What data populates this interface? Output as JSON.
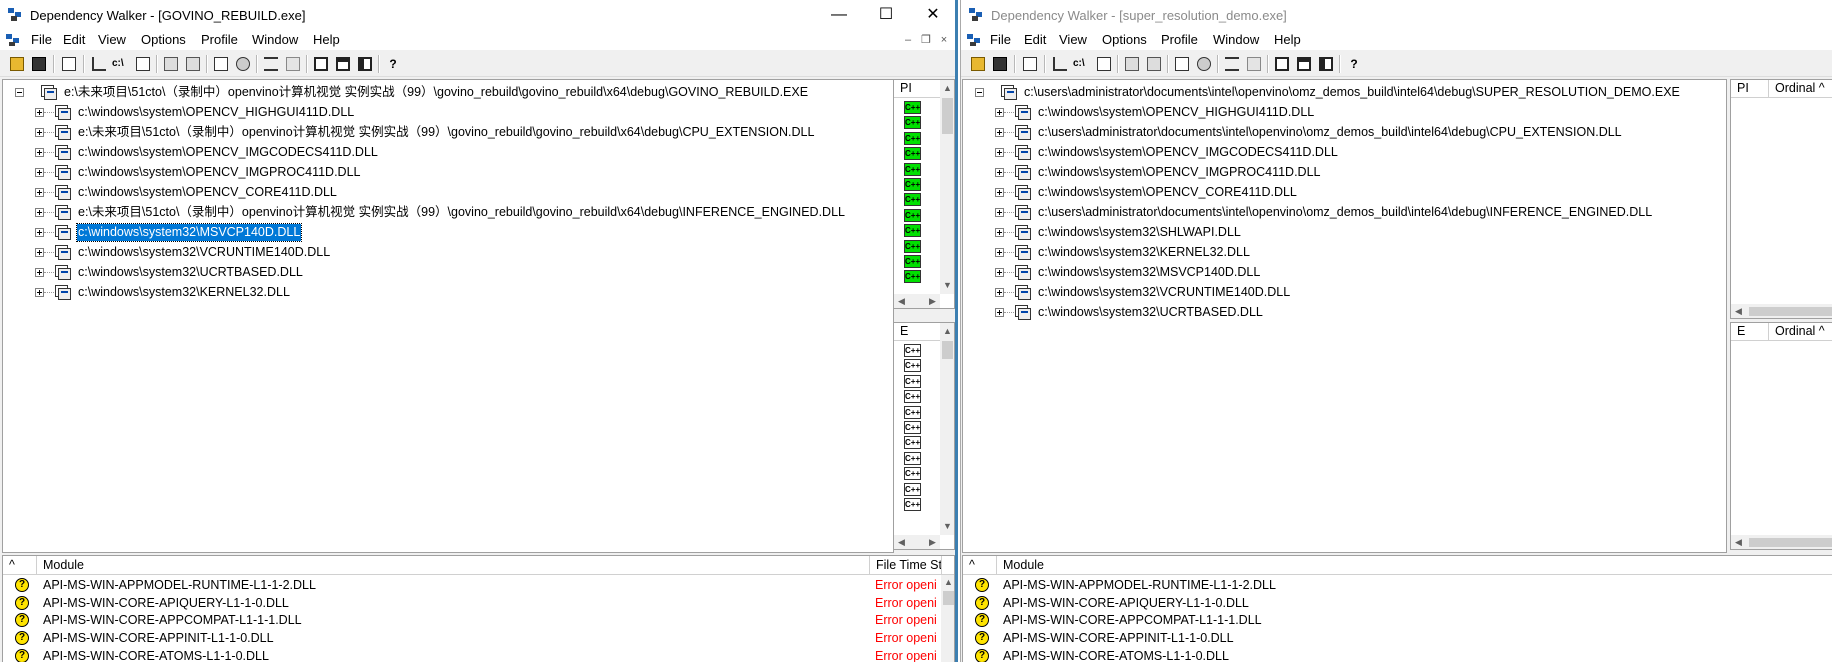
{
  "left": {
    "title": "Dependency Walker - [GOVINO_REBUILD.exe]",
    "menu": [
      "File",
      "Edit",
      "View",
      "Options",
      "Profile",
      "Window",
      "Help"
    ],
    "tree_root": "e:\\未来项目\\51cto\\（录制中）openvino计算机视觉 实例实战（99）\\govino_rebuild\\govino_rebuild\\x64\\debug\\GOVINO_REBUILD.EXE",
    "tree_items": [
      "c:\\windows\\system\\OPENCV_HIGHGUI411D.DLL",
      "e:\\未来项目\\51cto\\（录制中）openvino计算机视觉 实例实战（99）\\govino_rebuild\\govino_rebuild\\x64\\debug\\CPU_EXTENSION.DLL",
      "c:\\windows\\system\\OPENCV_IMGCODECS411D.DLL",
      "c:\\windows\\system\\OPENCV_IMGPROC411D.DLL",
      "c:\\windows\\system\\OPENCV_CORE411D.DLL",
      "e:\\未来项目\\51cto\\（录制中）openvino计算机视觉 实例实战（99）\\govino_rebuild\\govino_rebuild\\x64\\debug\\INFERENCE_ENGINED.DLL",
      "c:\\windows\\system32\\MSVCP140D.DLL",
      "c:\\windows\\system32\\VCRUNTIME140D.DLL",
      "c:\\windows\\system32\\UCRTBASED.DLL",
      "c:\\windows\\system32\\KERNEL32.DLL"
    ],
    "selected_index": 6,
    "pi_header": "PI",
    "e_header": "E",
    "cpp_glyph": "C++",
    "pi_count": 12,
    "e_count": 11,
    "log_headers": {
      "sort": "^",
      "module": "Module",
      "filetime": "File Time St"
    },
    "log_rows": [
      {
        "module": "API-MS-WIN-APPMODEL-RUNTIME-L1-1-2.DLL",
        "status": "Error openi"
      },
      {
        "module": "API-MS-WIN-CORE-APIQUERY-L1-1-0.DLL",
        "status": "Error openi"
      },
      {
        "module": "API-MS-WIN-CORE-APPCOMPAT-L1-1-1.DLL",
        "status": "Error openi"
      },
      {
        "module": "API-MS-WIN-CORE-APPINIT-L1-1-0.DLL",
        "status": "Error openi"
      },
      {
        "module": "API-MS-WIN-CORE-ATOMS-L1-1-0.DLL",
        "status": "Error openi"
      }
    ]
  },
  "right": {
    "title": "Dependency Walker - [super_resolution_demo.exe]",
    "menu": [
      "File",
      "Edit",
      "View",
      "Options",
      "Profile",
      "Window",
      "Help"
    ],
    "tree_root": "c:\\users\\administrator\\documents\\intel\\openvino\\omz_demos_build\\intel64\\debug\\SUPER_RESOLUTION_DEMO.EXE",
    "tree_items": [
      "c:\\windows\\system\\OPENCV_HIGHGUI411D.DLL",
      "c:\\users\\administrator\\documents\\intel\\openvino\\omz_demos_build\\intel64\\debug\\CPU_EXTENSION.DLL",
      "c:\\windows\\system\\OPENCV_IMGCODECS411D.DLL",
      "c:\\windows\\system\\OPENCV_IMGPROC411D.DLL",
      "c:\\windows\\system\\OPENCV_CORE411D.DLL",
      "c:\\users\\administrator\\documents\\intel\\openvino\\omz_demos_build\\intel64\\debug\\INFERENCE_ENGINED.DLL",
      "c:\\windows\\system32\\SHLWAPI.DLL",
      "c:\\windows\\system32\\KERNEL32.DLL",
      "c:\\windows\\system32\\MSVCP140D.DLL",
      "c:\\windows\\system32\\VCRUNTIME140D.DLL",
      "c:\\windows\\system32\\UCRTBASED.DLL"
    ],
    "pi_header": "PI",
    "ordinal_header": "Ordinal ^",
    "e_header": "E",
    "log_headers": {
      "sort": "^",
      "module": "Module"
    },
    "log_rows": [
      {
        "module": "API-MS-WIN-APPMODEL-RUNTIME-L1-1-2.DLL"
      },
      {
        "module": "API-MS-WIN-CORE-APIQUERY-L1-1-0.DLL"
      },
      {
        "module": "API-MS-WIN-CORE-APPCOMPAT-L1-1-1.DLL"
      },
      {
        "module": "API-MS-WIN-CORE-APPINIT-L1-1-0.DLL"
      },
      {
        "module": "API-MS-WIN-CORE-ATOMS-L1-1-0.DLL"
      }
    ]
  },
  "window_controls": {
    "minimize": "—",
    "maximize": "☐",
    "close": "✕"
  },
  "mdi_controls": {
    "minimize": "–",
    "restore": "❐",
    "close": "×"
  },
  "icons": {
    "app": "dependency-walker-icon",
    "module": "module-icon",
    "cpp_green": "#00e000",
    "status_question": "question-icon",
    "selection": "#0078d7",
    "error_text": "#ff0000"
  }
}
